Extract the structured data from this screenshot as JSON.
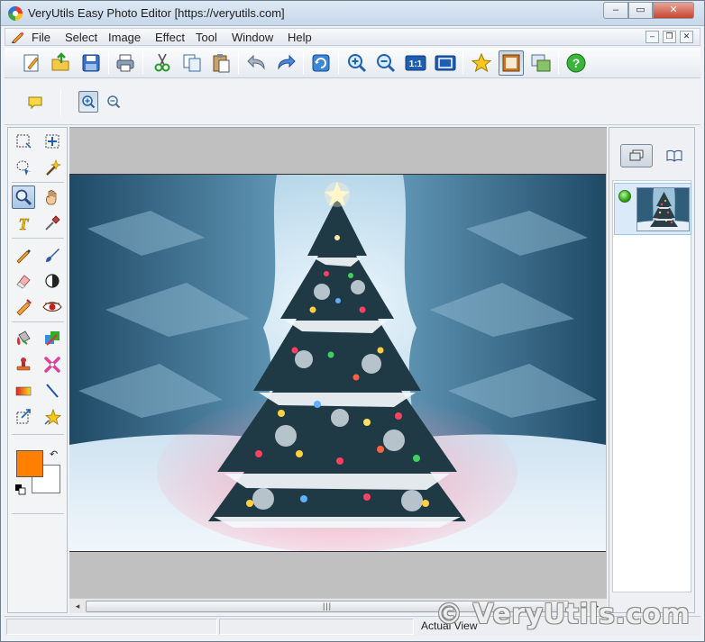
{
  "window": {
    "title": "VeryUtils Easy Photo Editor [https://veryutils.com]",
    "controls": {
      "minimize": "–",
      "maximize": "▭",
      "close": "✕"
    }
  },
  "menubar": {
    "items": [
      {
        "label": "File"
      },
      {
        "label": "Select"
      },
      {
        "label": "Image"
      },
      {
        "label": "Effect"
      },
      {
        "label": "Tool"
      },
      {
        "label": "Window"
      },
      {
        "label": "Help"
      }
    ],
    "mdi_controls": {
      "minimize": "–",
      "restore": "❐",
      "close": "✕"
    }
  },
  "toolbar": {
    "buttons": [
      {
        "name": "new-icon"
      },
      {
        "name": "open-icon"
      },
      {
        "name": "save-icon"
      },
      {
        "name": "print-icon"
      },
      {
        "name": "cut-icon"
      },
      {
        "name": "copy-icon"
      },
      {
        "name": "paste-icon"
      },
      {
        "name": "undo-icon"
      },
      {
        "name": "redo-icon"
      },
      {
        "name": "refresh-icon"
      },
      {
        "name": "zoom-in-icon"
      },
      {
        "name": "zoom-out-icon"
      },
      {
        "name": "actual-size-icon",
        "text": "1:1"
      },
      {
        "name": "fit-window-icon"
      },
      {
        "name": "favorite-icon"
      },
      {
        "name": "frame-icon"
      },
      {
        "name": "slideshow-icon"
      },
      {
        "name": "help-icon",
        "text": "?"
      }
    ]
  },
  "toolbar2": {
    "buttons": [
      {
        "name": "comment-icon"
      },
      {
        "name": "zoom-in-small-icon"
      },
      {
        "name": "zoom-out-small-icon"
      }
    ]
  },
  "tools": {
    "items": [
      {
        "name": "rect-select-icon"
      },
      {
        "name": "move-icon"
      },
      {
        "name": "lasso-icon"
      },
      {
        "name": "magic-wand-icon"
      },
      {
        "name": "zoom-tool-icon"
      },
      {
        "name": "hand-icon"
      },
      {
        "name": "text-tool-icon",
        "text": "T"
      },
      {
        "name": "eyedropper-icon"
      },
      {
        "name": "pencil-icon"
      },
      {
        "name": "brush-icon"
      },
      {
        "name": "eraser-icon"
      },
      {
        "name": "contrast-icon"
      },
      {
        "name": "sharpen-icon"
      },
      {
        "name": "red-eye-icon"
      },
      {
        "name": "fill-icon"
      },
      {
        "name": "color-replace-icon"
      },
      {
        "name": "stamp-icon"
      },
      {
        "name": "heal-icon"
      },
      {
        "name": "gradient-icon"
      },
      {
        "name": "line-icon"
      },
      {
        "name": "transform-icon"
      },
      {
        "name": "shape-star-icon"
      }
    ],
    "foreground_color": "#ff7f00",
    "background_color": "#ffffff",
    "swap_symbol": "↶"
  },
  "canvas": {
    "background": "#c0c0c0"
  },
  "scrollbar": {
    "left_arrow": "◂",
    "right_arrow": "▸",
    "grip": "|||"
  },
  "right_panel": {
    "buttons": [
      {
        "name": "layers-icon"
      },
      {
        "name": "book-icon"
      }
    ]
  },
  "statusbar": {
    "zoom_mode": "Actual View"
  },
  "watermark": "© VeryUtils.com"
}
